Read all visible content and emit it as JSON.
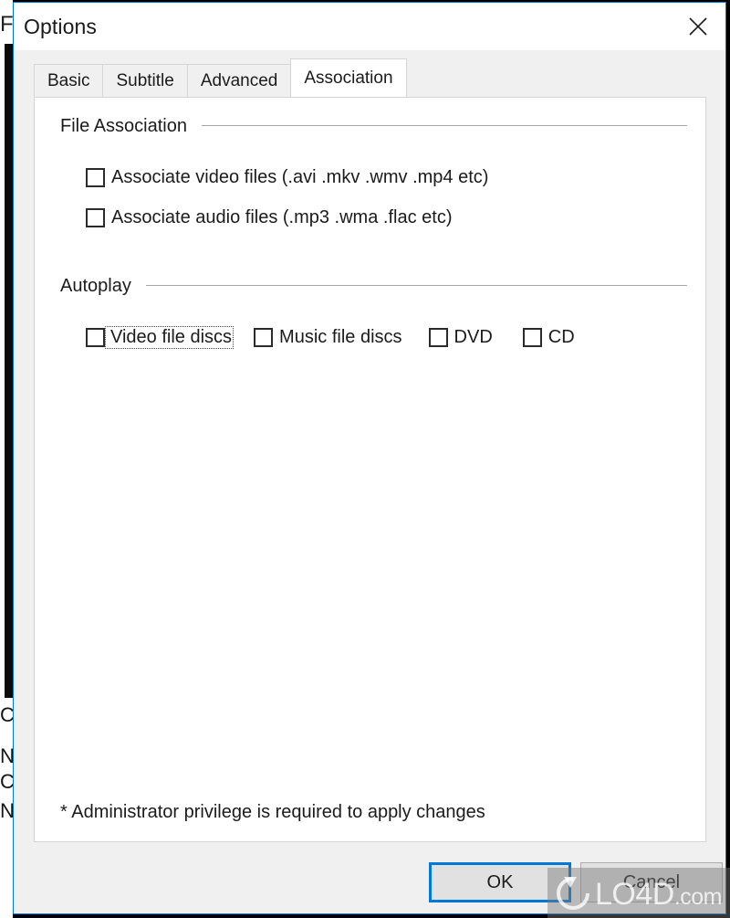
{
  "window": {
    "title": "Options",
    "close_icon": "close-icon",
    "accent_color": "#0078d7",
    "body_color": "#f0f0f0",
    "panel_color": "#ffffff"
  },
  "tabs": [
    {
      "label": "Basic",
      "active": false
    },
    {
      "label": "Subtitle",
      "active": false
    },
    {
      "label": "Advanced",
      "active": false
    },
    {
      "label": "Association",
      "active": true
    }
  ],
  "groups": [
    {
      "title": "File Association",
      "checkboxes": [
        {
          "label": "Associate video files (.avi .mkv .wmv .mp4 etc)",
          "checked": false,
          "focused": false
        },
        {
          "label": "Associate audio files (.mp3 .wma .flac etc)",
          "checked": false,
          "focused": false
        }
      ]
    },
    {
      "title": "Autoplay",
      "checkboxes": [
        {
          "label": "Video file discs",
          "checked": false,
          "focused": true
        },
        {
          "label": "Music file discs",
          "checked": false,
          "focused": false
        },
        {
          "label": "DVD",
          "checked": false,
          "focused": false
        },
        {
          "label": "CD",
          "checked": false,
          "focused": false
        }
      ]
    }
  ],
  "note": "* Administrator privilege is required to apply changes",
  "buttons": {
    "ok": "OK",
    "cancel": "Cancel"
  },
  "watermark": {
    "text": "LO4D",
    "tld": ".com"
  },
  "background": {
    "title_fragment": "F",
    "fragment_a": "C",
    "fragment_b": "N",
    "fragment_c": "C",
    "fragment_d": "N"
  }
}
